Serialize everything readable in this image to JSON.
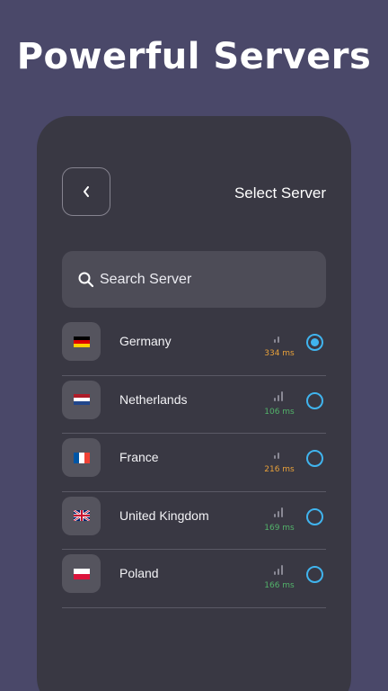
{
  "headline": "Powerful Servers",
  "screen": {
    "title": "Select Server",
    "back_icon": "chevron-left-icon",
    "search": {
      "placeholder": "Search Server",
      "icon": "search-icon"
    }
  },
  "colors": {
    "background": "#4a4869",
    "panel": "#393843",
    "accent": "#40b4ee",
    "ping_slow": "#e8a13a",
    "ping_fast": "#52b26a"
  },
  "servers": [
    {
      "country": "Germany",
      "ping": "334 ms",
      "ping_color": "#e8a13a",
      "signal_level": 2,
      "selected": true,
      "flag": [
        "#000000",
        "#dd0000",
        "#ffce00"
      ],
      "flag_dir": "h"
    },
    {
      "country": "Netherlands",
      "ping": "106 ms",
      "ping_color": "#52b26a",
      "signal_level": 3,
      "selected": false,
      "flag": [
        "#ae1c28",
        "#ffffff",
        "#21468b"
      ],
      "flag_dir": "h"
    },
    {
      "country": "France",
      "ping": "216 ms",
      "ping_color": "#e8a13a",
      "signal_level": 2,
      "selected": false,
      "flag": [
        "#0055a4",
        "#ffffff",
        "#ef4135"
      ],
      "flag_dir": "v"
    },
    {
      "country": "United Kingdom",
      "ping": "169 ms",
      "ping_color": "#52b26a",
      "signal_level": 3,
      "selected": false,
      "flag": [
        "uk"
      ],
      "flag_dir": "uk"
    },
    {
      "country": "Poland",
      "ping": "166 ms",
      "ping_color": "#52b26a",
      "signal_level": 3,
      "selected": false,
      "flag": [
        "#ffffff",
        "#dc143c"
      ],
      "flag_dir": "h"
    }
  ]
}
